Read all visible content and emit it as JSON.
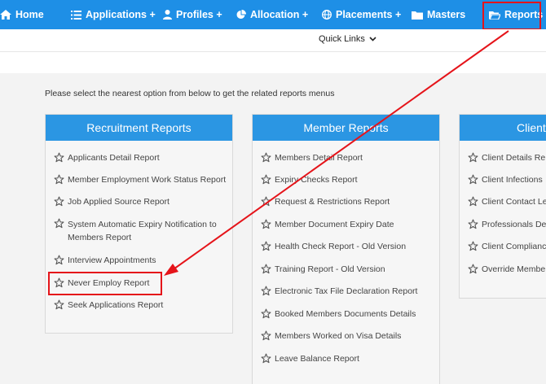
{
  "nav": {
    "home": "Home",
    "applications": "Applications +",
    "profiles": "Profiles +",
    "allocation": "Allocation +",
    "placements": "Placements +",
    "masters": "Masters",
    "reports": "Reports"
  },
  "quick_links": "Quick Links",
  "intro": "Please select the nearest option from below to get the related reports menus",
  "panels": [
    {
      "title": "Recruitment Reports",
      "items": [
        "Applicants Detail Report",
        "Member Employment Work Status Report",
        "Job Applied Source Report",
        "System Automatic Expiry Notification to Members Report",
        "Interview Appointments",
        "Never Employ Report",
        "Seek Applications Report"
      ]
    },
    {
      "title": "Member Reports",
      "items": [
        "Members Detail Report",
        "Expiry Checks Report",
        "Request & Restrictions Report",
        "Member Document Expiry Date",
        "Health Check Report - Old Version",
        "Training Report - Old Version",
        "Electronic Tax File Declaration Report",
        "Booked Members Documents Details",
        "Members Worked on Visa Details",
        "Leave Balance Report"
      ]
    },
    {
      "title": "Client",
      "items": [
        "Client Details Re",
        "Client Infections",
        "Client Contact Le",
        "Professionals Det",
        "Client Complianc",
        "Override Membe"
      ]
    }
  ],
  "colors": {
    "nav_bg": "#1e8fe6",
    "panel_header": "#2b96e3",
    "annotation_red": "#e5141a"
  }
}
